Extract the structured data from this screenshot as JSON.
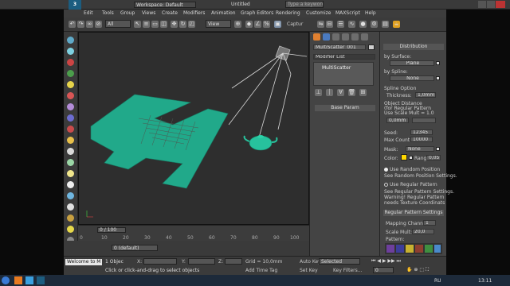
{
  "titlebar": {
    "workspace": "Workspace: Default",
    "title": "Untitled",
    "search_placeholder": "Type a keyword or phrase"
  },
  "menu": [
    "Edit",
    "Tools",
    "Group",
    "Views",
    "Create",
    "Modifiers",
    "Animation",
    "Graph Editors",
    "Rendering",
    "Customize",
    "MAXScript",
    "Help"
  ],
  "toolbar": {
    "filter_select": "All",
    "ref_coord": "View",
    "capture_label": "Captur"
  },
  "command_panel": {
    "object_name": "MultiScatter_001",
    "modifier_list": "Modifier List",
    "stack_item": "MultiScatter",
    "base_param": "Base Param"
  },
  "rollout": {
    "distribution": "Distribution",
    "by_surface": "by Surface:",
    "surface_value": "Plane",
    "by_spline": "by Spline:",
    "spline_value": "None",
    "spline_option": "Spline Option",
    "thickness": "Thickness:",
    "thickness_value": "1,0mm",
    "object_distance": "Object Distance",
    "regular_pattern_note": "(for Regular Pattern",
    "scale_note": "Use Scale Mult = 1.0",
    "distance_value": "0,0mm",
    "seed_label": "Seed:",
    "seed_value": "12345",
    "max_count_label": "Max Count:",
    "max_count_value": "10000",
    "mask_label": "Mask:",
    "mask_value": "None",
    "color_label": "Color:",
    "range_label": "Range",
    "range_value": "0,05",
    "use_random": "Use Random Position",
    "see_random": "See Random Position Settings.",
    "use_regular": "Use Regular Pattern",
    "see_regular": "See Regular Pattern Settings.",
    "warning": "Warning! Regular Pattern",
    "needs": "needs Texture Coordinats",
    "regular_settings": "Regular Pattern Settings",
    "mapping_channel_label": "Mapping Channel:",
    "mapping_channel_value": "1",
    "scale_mult_label": "Scale Mult:",
    "scale_mult_value": "20,0",
    "pattern_label": "Pattern:"
  },
  "timeline": {
    "frame": "0 / 100",
    "ticks": [
      "0",
      "10",
      "20",
      "30",
      "40",
      "50",
      "60",
      "70",
      "80",
      "90",
      "100"
    ]
  },
  "status": {
    "selection": "1 Objec",
    "x_label": "X:",
    "y_label": "Y:",
    "z_label": "Z:",
    "grid": "Grid = 10,0mm",
    "hint": "Click or click-and-drag to select objects",
    "add_time_tag": "Add Time Tag",
    "auto_key": "Auto Key",
    "selected": "Selected",
    "set_key": "Set Key",
    "key_filters": "Key Filters...",
    "frame_value": "0",
    "welcome": "Welcome to M",
    "layer": "0 (default)"
  },
  "taskbar": {
    "lang": "RU",
    "time": "13:11"
  },
  "colors": {
    "teal": "#21a98a",
    "accent": "#ffd800"
  }
}
